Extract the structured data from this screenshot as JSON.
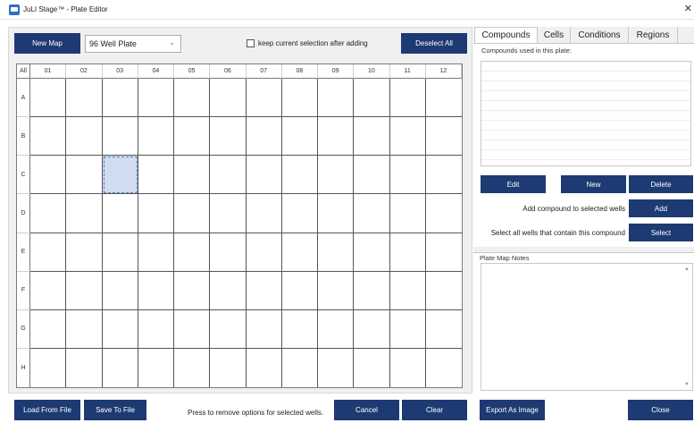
{
  "window": {
    "title": "JuLI Stage™ - Plate Editor",
    "close_glyph": "✕"
  },
  "toolbar": {
    "new_map": "New Map",
    "plate_type": "96 Well Plate",
    "keep_selection_label": "keep current selection after adding",
    "keep_selection_checked": false,
    "deselect_all": "Deselect All"
  },
  "plate": {
    "corner": "All",
    "columns": [
      "01",
      "02",
      "03",
      "04",
      "05",
      "06",
      "07",
      "08",
      "09",
      "10",
      "11",
      "12"
    ],
    "rows": [
      "A",
      "B",
      "C",
      "D",
      "E",
      "F",
      "G",
      "H"
    ],
    "selected_wells": [
      "C03"
    ]
  },
  "bottom": {
    "load": "Load From File",
    "save": "Save To File",
    "hint": "Press to remove options for selected wells.",
    "cancel": "Cancel",
    "clear": "Clear",
    "export": "Export As Image",
    "close": "Close"
  },
  "tabs": [
    "Compounds",
    "Cells",
    "Conditions",
    "Regions"
  ],
  "active_tab": "Compounds",
  "compounds": {
    "list_label": "Compounds used in this plate:",
    "items": [],
    "edit": "Edit",
    "new": "New",
    "delete": "Delete",
    "add_label": "Add compound to selected wells",
    "add": "Add",
    "select_label": "Select all wells that contain this compound",
    "select": "Select"
  },
  "notes": {
    "label": "Plate Map Notes",
    "value": ""
  },
  "colors": {
    "button_bg": "#1d3a73",
    "selected_well": "#d0dcef",
    "pane_bg": "#f0f0f0"
  },
  "icons": {
    "app": "app-window-icon",
    "dropdown": "chevron-down-icon",
    "close": "close-icon"
  }
}
